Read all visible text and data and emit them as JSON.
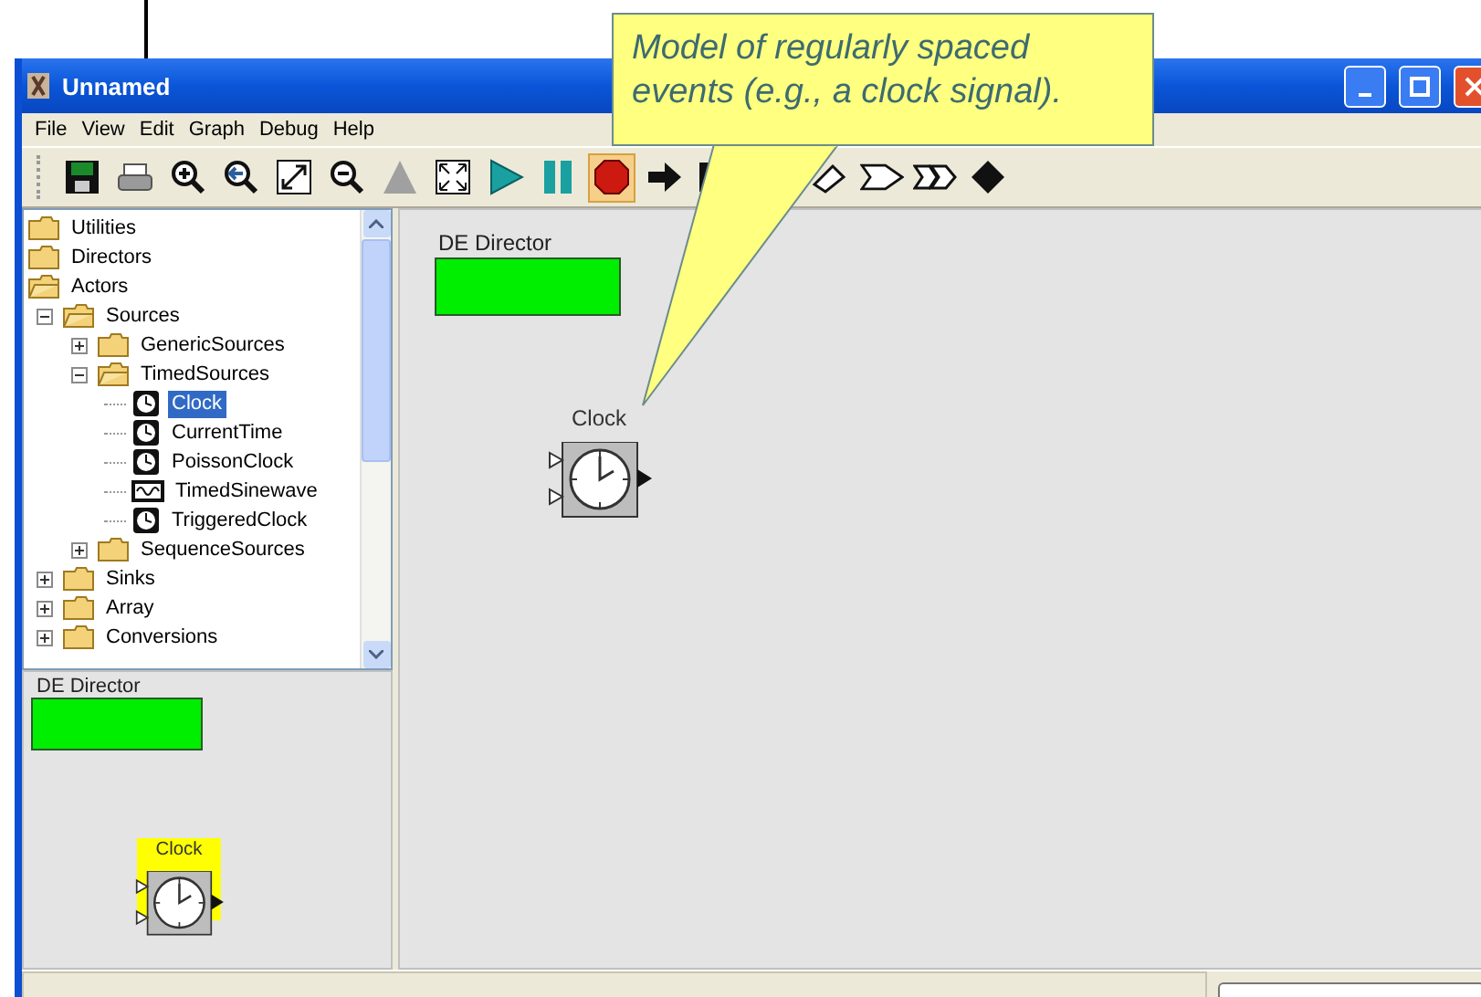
{
  "window": {
    "title": "Unnamed"
  },
  "menu": [
    "File",
    "View",
    "Edit",
    "Graph",
    "Debug",
    "Help"
  ],
  "toolbar": [
    {
      "kind": "save",
      "selected": false,
      "disabled": false
    },
    {
      "kind": "print",
      "selected": false,
      "disabled": false
    },
    {
      "kind": "zoom-in",
      "selected": false,
      "disabled": false
    },
    {
      "kind": "zoom-reset",
      "selected": false,
      "disabled": false
    },
    {
      "kind": "zoom-fit",
      "selected": false,
      "disabled": false
    },
    {
      "kind": "zoom-out",
      "selected": false,
      "disabled": false
    },
    {
      "kind": "triangle",
      "selected": false,
      "disabled": true
    },
    {
      "kind": "fullscreen",
      "selected": false,
      "disabled": false
    },
    {
      "kind": "play",
      "selected": false,
      "disabled": false
    },
    {
      "kind": "pause",
      "selected": false,
      "disabled": false
    },
    {
      "kind": "stop",
      "selected": true,
      "disabled": false
    },
    {
      "kind": "arrow",
      "selected": false,
      "disabled": false
    },
    {
      "kind": "step",
      "selected": false,
      "disabled": false
    },
    {
      "kind": "pointer",
      "selected": false,
      "disabled": false
    },
    {
      "kind": "outline-arrow",
      "selected": false,
      "disabled": false
    },
    {
      "kind": "double-arrow",
      "selected": false,
      "disabled": false
    },
    {
      "kind": "diamond",
      "selected": false,
      "disabled": false
    }
  ],
  "tree": [
    {
      "label": "Utilities",
      "kind": "folder",
      "selected": false
    },
    {
      "label": "Directors",
      "kind": "folder",
      "selected": false
    },
    {
      "label": "Actors",
      "kind": "folder",
      "selected": false,
      "children": [
        {
          "label": "Sources",
          "kind": "folder",
          "expanded": true,
          "selected": false,
          "children": [
            {
              "label": "GenericSources",
              "kind": "folder",
              "expanded": false,
              "selected": false
            },
            {
              "label": "TimedSources",
              "kind": "folder",
              "expanded": true,
              "selected": false,
              "children": [
                {
                  "label": "Clock",
                  "kind": "clock",
                  "selected": true
                },
                {
                  "label": "CurrentTime",
                  "kind": "clock",
                  "selected": false
                },
                {
                  "label": "PoissonClock",
                  "kind": "clock",
                  "selected": false
                },
                {
                  "label": "TimedSinewave",
                  "kind": "sinewave",
                  "selected": false
                },
                {
                  "label": "TriggeredClock",
                  "kind": "clock",
                  "selected": false
                }
              ]
            },
            {
              "label": "SequenceSources",
              "kind": "folder",
              "expanded": false,
              "selected": false
            }
          ]
        },
        {
          "label": "Sinks",
          "kind": "folder",
          "expanded": false,
          "selected": false
        },
        {
          "label": "Array",
          "kind": "folder",
          "expanded": false,
          "selected": false
        },
        {
          "label": "Conversions",
          "kind": "folder",
          "expanded": false,
          "selected": false
        }
      ]
    }
  ],
  "preview": {
    "director": {
      "label": "DE Director"
    },
    "actor": {
      "label": "Clock",
      "highlighted": true
    }
  },
  "canvas": {
    "director": {
      "label": "DE Director"
    },
    "actor": {
      "label": "Clock",
      "highlighted": false
    }
  },
  "callout": {
    "text": "Model of regularly spaced events (e.g., a clock signal)."
  }
}
